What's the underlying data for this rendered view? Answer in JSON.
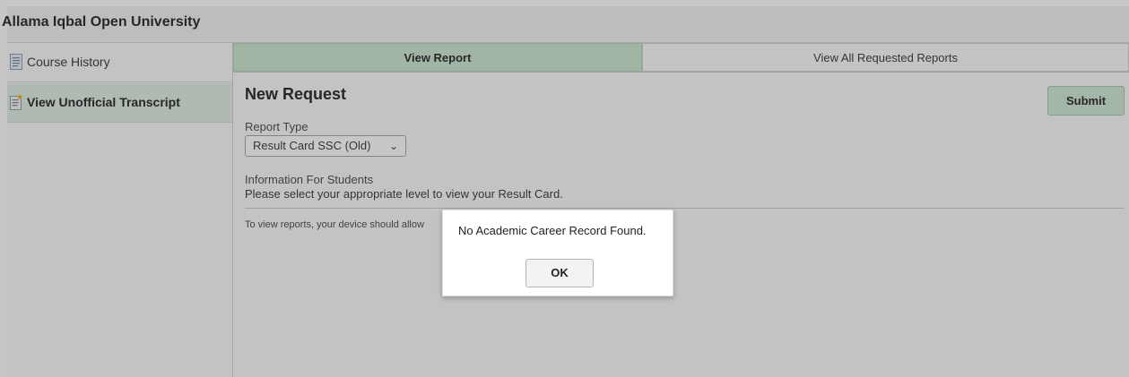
{
  "header": {
    "title": "Allama Iqbal Open University"
  },
  "sidebar": {
    "items": [
      {
        "label": "Course History",
        "icon": "document-icon"
      },
      {
        "label": "View Unofficial Transcript",
        "icon": "document-star-icon"
      }
    ]
  },
  "tabs": [
    {
      "label": "View Report",
      "active": true
    },
    {
      "label": "View All Requested Reports",
      "active": false
    }
  ],
  "main": {
    "heading": "New Request",
    "submit_label": "Submit",
    "report_type_label": "Report Type",
    "report_type_value": "Result Card SSC (Old)",
    "info_title": "Information For Students",
    "info_text": "Please select your appropriate level to view your Result Card.",
    "note": "To view reports, your device should allow"
  },
  "dialog": {
    "message": "No Academic Career Record Found.",
    "ok_label": "OK"
  },
  "colors": {
    "accent_green": "#cfe8d4",
    "submit_green": "#d3e9d7",
    "overlay": "rgba(0,0,0,0.22)"
  }
}
